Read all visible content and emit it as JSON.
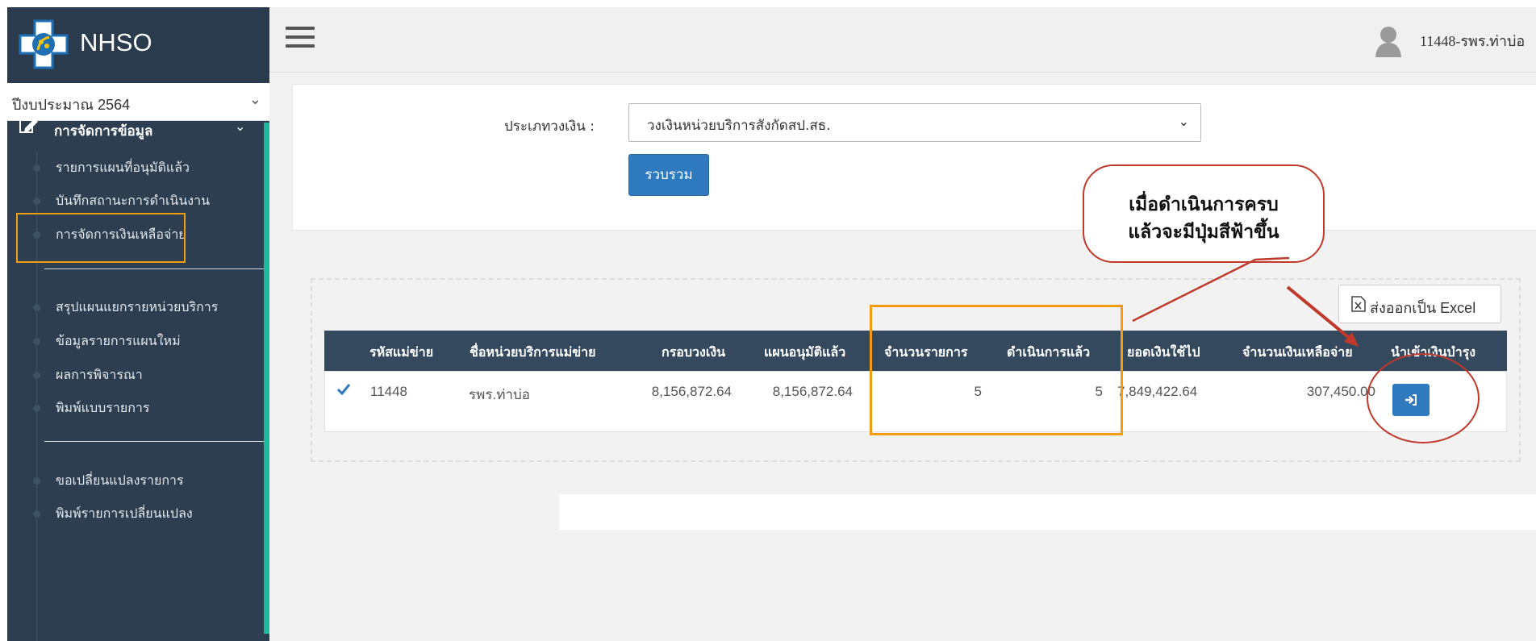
{
  "brand": {
    "name": "NHSO"
  },
  "sidebar": {
    "year_select": "ปีงบประมาณ 2564",
    "menu_header": "การจัดการข้อมูล",
    "items": [
      {
        "label": "รายการแผนที่อนุมัติแล้ว"
      },
      {
        "label": "บันทึกสถานะการดำเนินงาน"
      },
      {
        "label": "การจัดการเงินเหลือจ่าย"
      },
      {
        "label": "สรุปแผนแยกรายหน่วยบริการ"
      },
      {
        "label": "ข้อมูลรายการแผนใหม่"
      },
      {
        "label": "ผลการพิจารณา"
      },
      {
        "label": "พิมพ์แบบรายการ"
      },
      {
        "label": "ขอเปลี่ยนแปลงรายการ"
      },
      {
        "label": "พิมพ์รายการเปลี่ยนแปลง"
      }
    ]
  },
  "topbar": {
    "user": "11448-รพร.ท่าบ่อ"
  },
  "filter": {
    "label": "ประเภทวงเงิน :",
    "selected": "วงเงินหน่วยบริการสังกัดสป.สธ.",
    "submit": "รวบรวม"
  },
  "callout": {
    "line1": "เมื่อดำเนินการครบ",
    "line2": "แล้วจะมีปุ่มสีฟ้าขึ้น"
  },
  "export": {
    "label": "ส่งออกเป็น Excel"
  },
  "table": {
    "headers": [
      "รหัสแม่ข่าย",
      "ชื่อหน่วยบริการแม่ข่าย",
      "กรอบวงเงิน",
      "แผนอนุมัติแล้ว",
      "จำนวนรายการ",
      "ดำเนินการแล้ว",
      "ยอดเงินใช้ไป",
      "จำนวนเงินเหลือจ่าย",
      "นำเข้าเงินบำรุง"
    ],
    "rows": [
      {
        "code": "11448",
        "name": "รพร.ท่าบ่อ",
        "budget": "8,156,872.64",
        "approved": "8,156,872.64",
        "count": "5",
        "done": "5",
        "spent": "7,849,422.64",
        "remaining": "307,450.00"
      }
    ]
  },
  "colors": {
    "sidebar": "#2c3e50",
    "accent": "#1abc9c",
    "primary_button": "#2f7abf",
    "highlight": "#f39c12",
    "annotation": "#c0392b"
  }
}
